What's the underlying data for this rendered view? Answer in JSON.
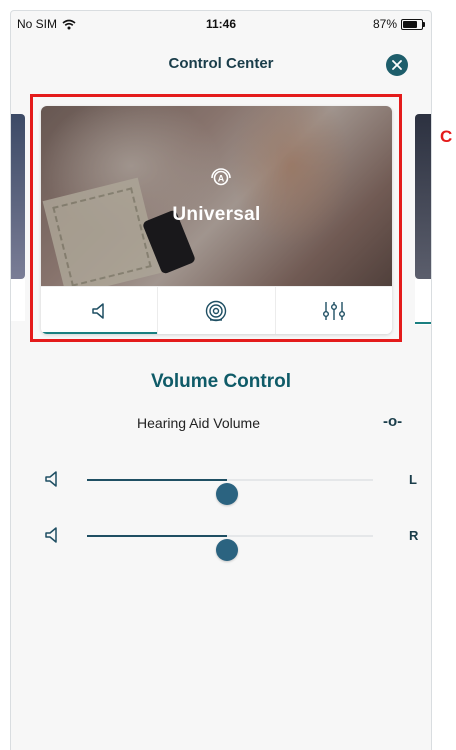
{
  "status": {
    "carrier": "No SIM",
    "time": "11:46",
    "battery": "87%",
    "battery_level": 0.87
  },
  "header": {
    "title": "Control Center",
    "close_icon": "close-icon"
  },
  "program": {
    "name": "Universal",
    "icon": "program-a-icon"
  },
  "tabs": [
    {
      "icon": "speaker-icon",
      "active": true
    },
    {
      "icon": "ear-signal-icon",
      "active": false
    },
    {
      "icon": "equalizer-icon",
      "active": false
    }
  ],
  "annotation": {
    "label": "C",
    "color": "#e41b1b"
  },
  "volume": {
    "title": "Volume Control",
    "subtitle": "Hearing Aid Volume",
    "link_symbol": "-o-",
    "left": {
      "label": "L",
      "value": 0.49
    },
    "right": {
      "label": "R",
      "value": 0.49
    }
  },
  "colors": {
    "accent": "#1a7f80",
    "title": "#0f5b68",
    "thumb": "#2b6380"
  }
}
